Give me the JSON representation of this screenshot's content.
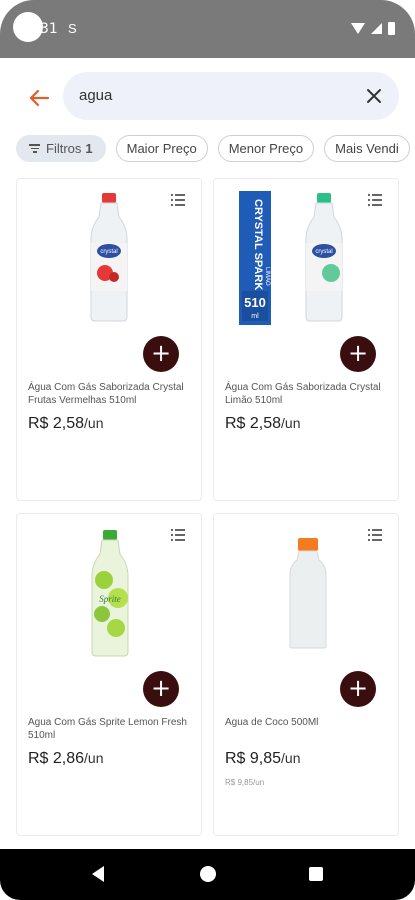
{
  "status_bar": {
    "time": "31",
    "extra": "S",
    "icons": [
      "wifi-icon",
      "signal-icon",
      "battery-icon"
    ]
  },
  "search": {
    "query": "agua",
    "back_icon": "arrow-left-icon",
    "clear_icon": "close-icon"
  },
  "filters": {
    "filter_label": "Filtros",
    "filter_count": "1",
    "chips": [
      "Maior Preço",
      "Menor Preço",
      "Mais Vendi"
    ]
  },
  "colors": {
    "accent": "#e0602a",
    "add_button": "#3a0e0e",
    "search_bg": "#eef1fa"
  },
  "products": [
    {
      "name": "Água Com Gás Saborizada Crystal Frutas Vermelhas 510ml",
      "price": "R$ 2,58",
      "unit": "/un",
      "subprice": ""
    },
    {
      "name": "Água Com Gás Saborizada Crystal Limão 510ml",
      "price": "R$ 2,58",
      "unit": "/un",
      "subprice": ""
    },
    {
      "name": "Agua Com Gás Sprite Lemon Fresh 510ml",
      "price": "R$ 2,86",
      "unit": "/un",
      "subprice": ""
    },
    {
      "name": "Agua de Coco 500Ml",
      "price": "R$ 9,85",
      "unit": "/un",
      "subprice": "R$ 9,85/un"
    }
  ],
  "product_image_texts": {
    "crystal_brand": "crystal",
    "sparkling_banner": "CRYSTAL SPARKLING",
    "sparkling_flavor": "LIMÃO",
    "sparkling_size": "510",
    "sparkling_unit": "ml",
    "sprite_brand": "Sprite"
  },
  "add_label": "+",
  "nav": {
    "icons": [
      "nav-back-icon",
      "nav-home-icon",
      "nav-recent-icon"
    ]
  }
}
